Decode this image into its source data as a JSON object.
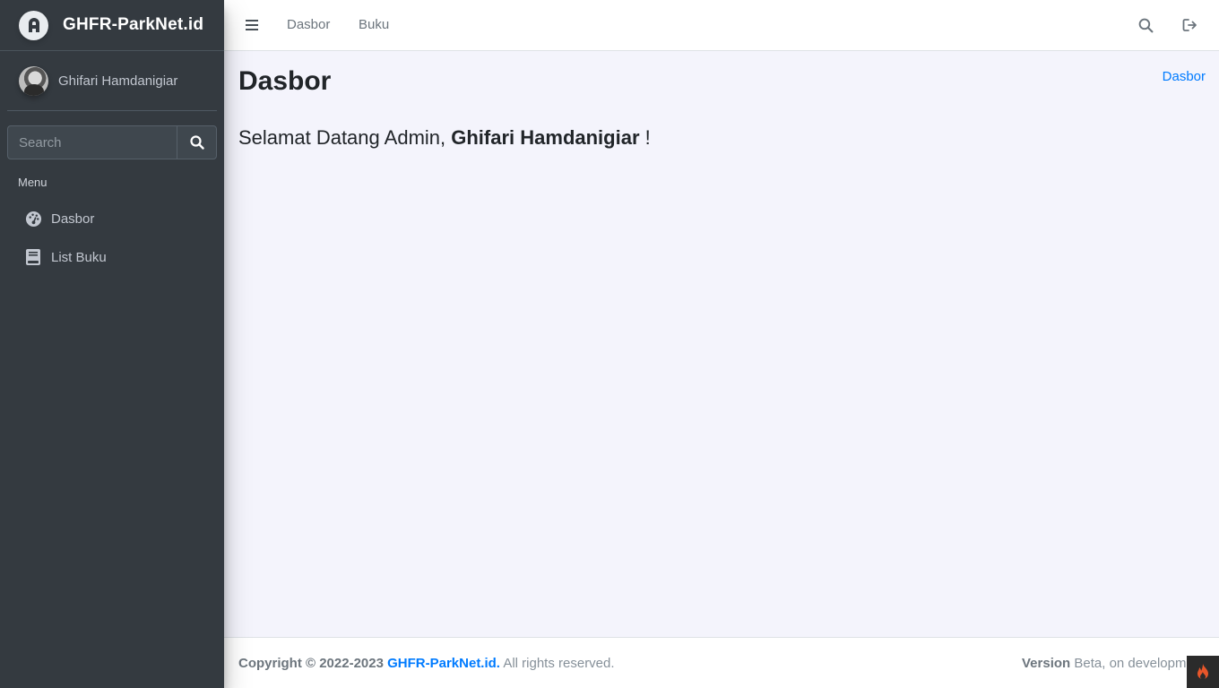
{
  "brand": {
    "name": "GHFR-ParkNet.id",
    "logo_icon": "brand-logo-icon"
  },
  "user": {
    "name": "Ghifari Hamdanigiar"
  },
  "sidebar": {
    "search_placeholder": "Search",
    "menu_header": "Menu",
    "items": [
      {
        "label": "Dasbor",
        "icon": "dashboard-icon"
      },
      {
        "label": "List Buku",
        "icon": "book-icon"
      }
    ]
  },
  "navbar": {
    "links": [
      "Dasbor",
      "Buku"
    ],
    "right_icons": [
      "search-icon",
      "logout-icon"
    ]
  },
  "content": {
    "title": "Dasbor",
    "breadcrumb": "Dasbor",
    "welcome_prefix": "Selamat Datang Admin, ",
    "welcome_name": "Ghifari Hamdanigiar",
    "welcome_suffix": " !"
  },
  "footer": {
    "copyright_prefix": "Copyright © 2022-2023 ",
    "copyright_link": "GHFR-ParkNet.id.",
    "copyright_suffix": " All rights reserved.",
    "version_label": "Version",
    "version_value": " Beta, on developm"
  },
  "colors": {
    "sidebar_bg": "#343a40",
    "content_bg": "#f4f4fc",
    "link": "#007bff",
    "badge_flame": "#e8562a"
  }
}
